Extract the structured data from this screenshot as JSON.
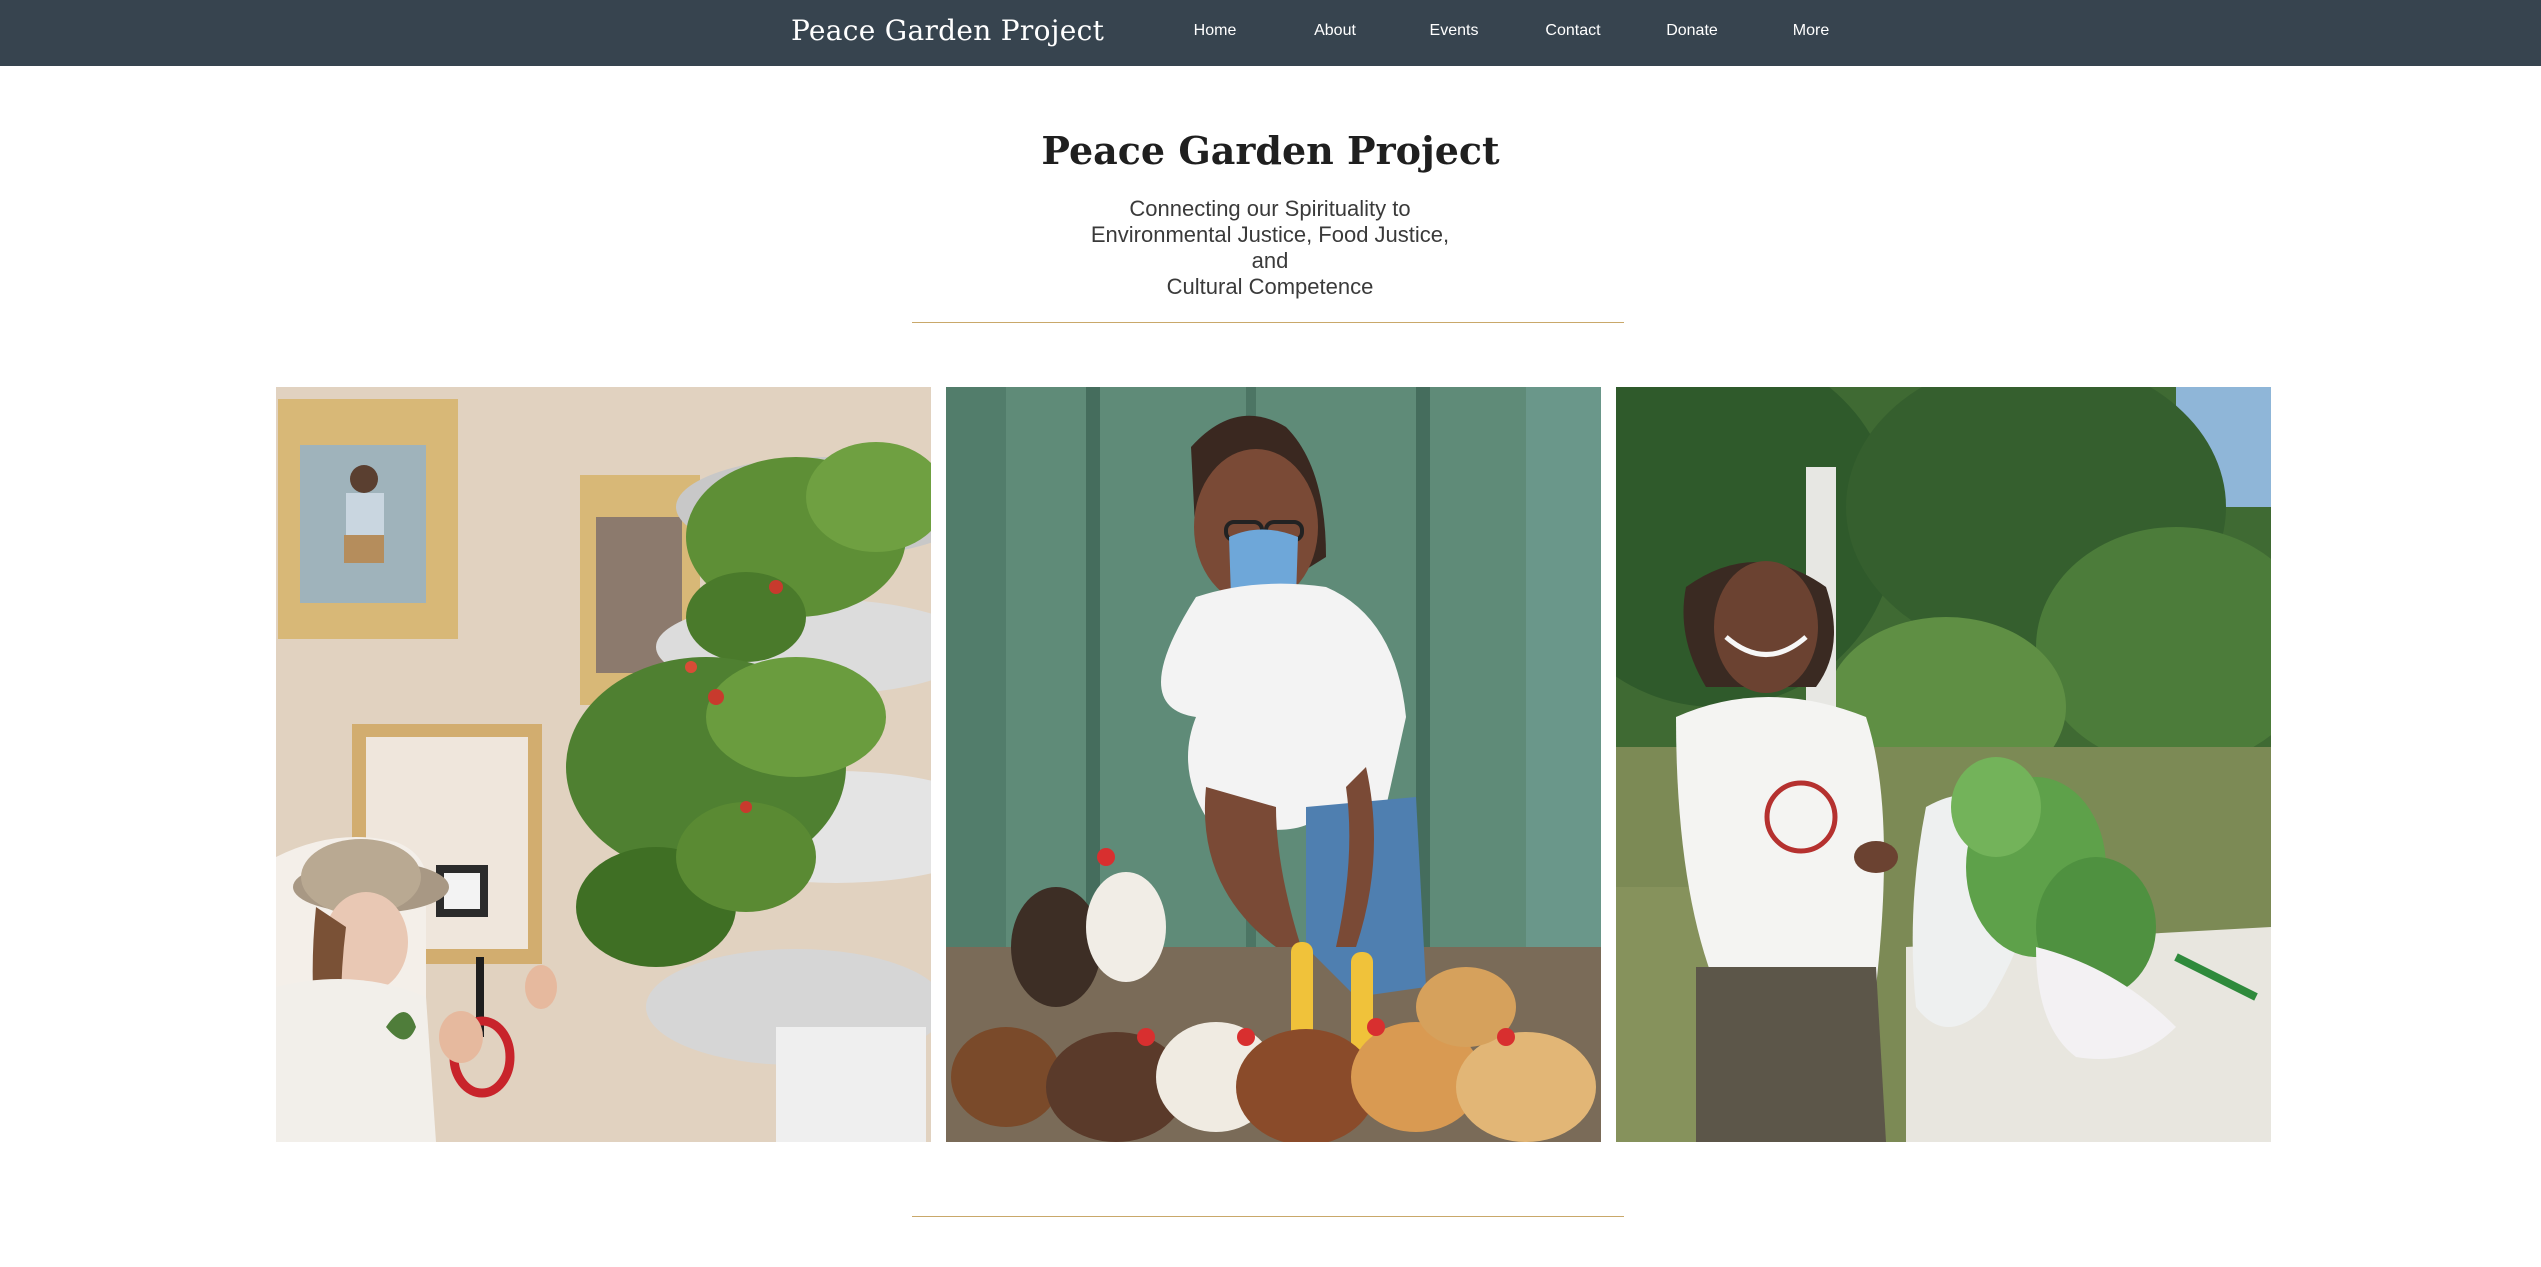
{
  "header": {
    "site_title": "Peace Garden Project",
    "nav": [
      "Home",
      "About",
      "Events",
      "Contact",
      "Donate",
      "More"
    ]
  },
  "hero": {
    "title": "Peace Garden Project",
    "tagline_lines": [
      "Connecting our Spirituality to",
      "Environmental Justice, Food Justice, and",
      "Cultural Competence"
    ]
  },
  "gallery": {
    "photos": [
      {
        "name": "garden-tower-harvest-photo"
      },
      {
        "name": "chicken-feeding-photo"
      },
      {
        "name": "greens-harvest-photo"
      }
    ]
  },
  "colors": {
    "header_bg": "#37444f",
    "divider": "#c9a86a",
    "page_bg": "#ffffff"
  }
}
